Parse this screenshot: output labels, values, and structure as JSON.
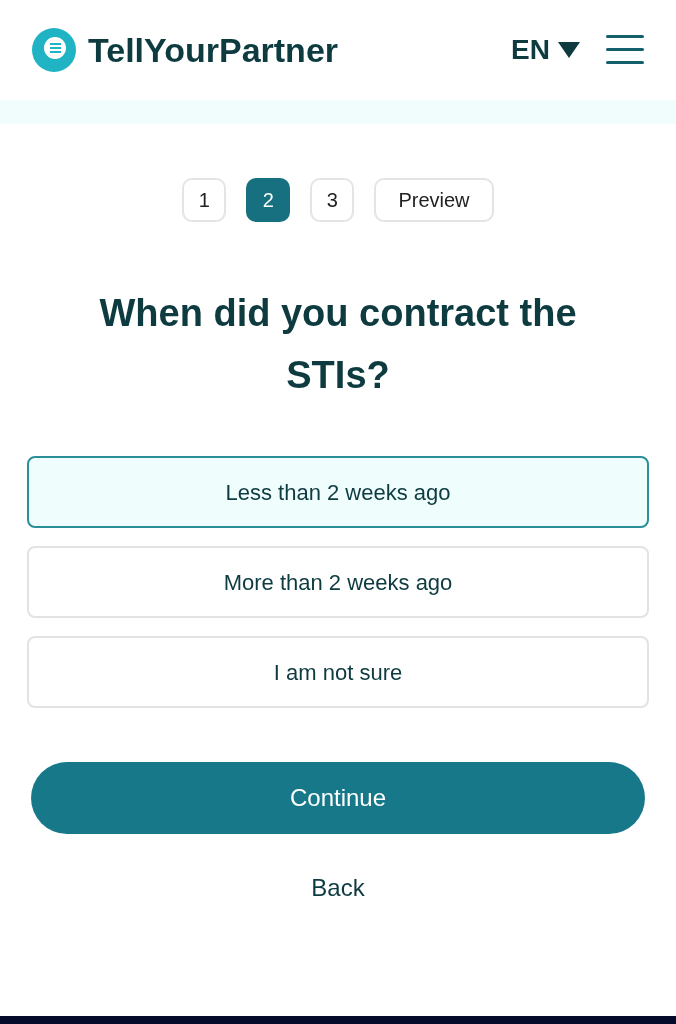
{
  "header": {
    "brand": "TellYourPartner",
    "language": "EN"
  },
  "steps": [
    {
      "label": "1",
      "selected": false
    },
    {
      "label": "2",
      "selected": true
    },
    {
      "label": "3",
      "selected": false
    },
    {
      "label": "Preview",
      "selected": false
    }
  ],
  "question": "When did you contract the STIs?",
  "options": [
    {
      "label": "Less than 2 weeks ago",
      "selected": true
    },
    {
      "label": "More than 2 weeks ago",
      "selected": false
    },
    {
      "label": "I am not sure",
      "selected": false
    }
  ],
  "continue_button": "Continue",
  "back_link": "Back"
}
